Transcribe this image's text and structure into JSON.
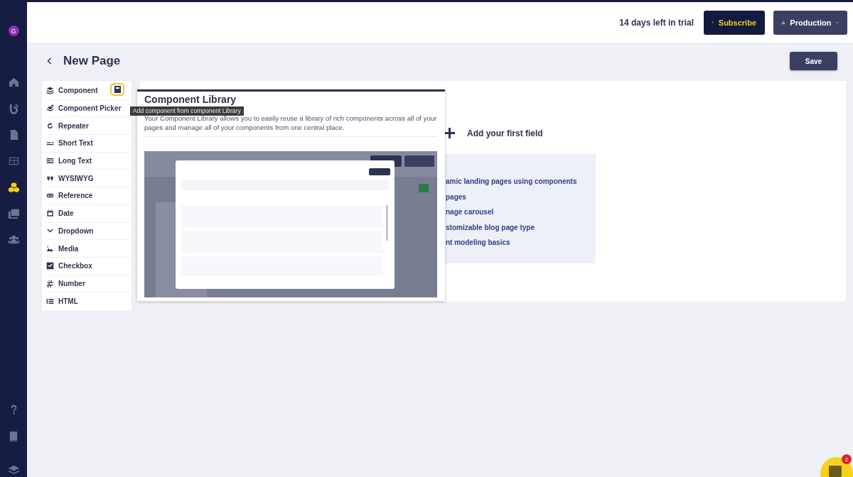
{
  "sidebar": {
    "avatar": "G",
    "items": [
      {
        "selected": false
      },
      {
        "selected": false
      },
      {
        "selected": false
      },
      {
        "selected": false
      },
      {
        "selected": true
      },
      {
        "selected": false
      },
      {
        "selected": false
      }
    ]
  },
  "topbar": {
    "trial": "14 days left in trial",
    "subscribe": "Subscribe",
    "environment": "Production"
  },
  "page": {
    "title": "New Page",
    "save": "Save"
  },
  "fields": [
    {
      "label": "Component"
    },
    {
      "label": "Component Picker"
    },
    {
      "label": "Repeater"
    },
    {
      "label": "Short Text"
    },
    {
      "label": "Long Text"
    },
    {
      "label": "WYSIWYG"
    },
    {
      "label": "Reference"
    },
    {
      "label": "Date"
    },
    {
      "label": "Dropdown"
    },
    {
      "label": "Media"
    },
    {
      "label": "Checkbox"
    },
    {
      "label": "Number"
    },
    {
      "label": "HTML"
    }
  ],
  "tooltip": "Add component from component Library",
  "library_popup": {
    "title": "Component Library",
    "description": "Your Component Library allows you to easily reuse a library of rich components across all of your pages and manage all of your components from one central place."
  },
  "empty_state": {
    "add_field": "Add your first field",
    "links": [
      "amic landing pages using components",
      "pages",
      "nage carousel",
      "stomizable blog page type",
      "nt modeling basics"
    ]
  },
  "chat": {
    "badge": "2"
  }
}
